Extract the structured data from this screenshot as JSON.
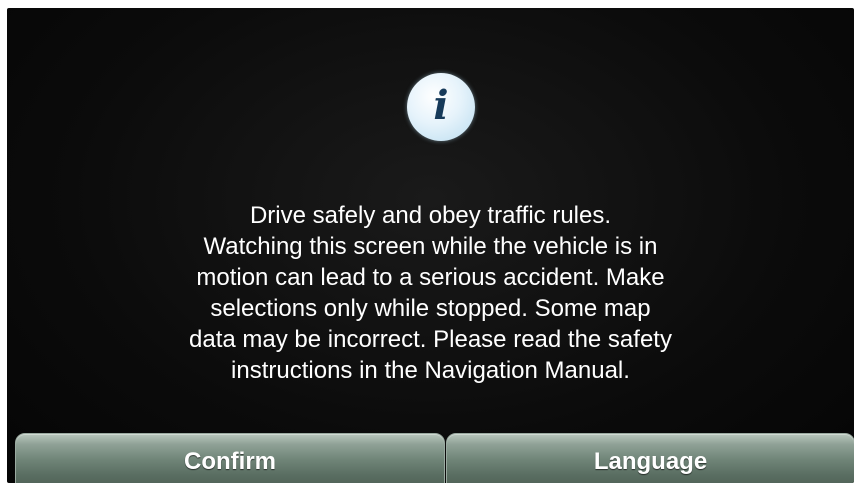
{
  "dialog": {
    "icon": "info-icon",
    "icon_glyph": "i",
    "message_lines": [
      "Drive safely and obey traffic rules.",
      "Watching this screen while the vehicle is in",
      "motion can lead to a serious accident. Make",
      "selections only while stopped. Some map",
      "data may be incorrect. Please read the safety",
      "instructions in the Navigation Manual."
    ]
  },
  "buttons": {
    "confirm_label": "Confirm",
    "language_label": "Language"
  },
  "colors": {
    "background": "#0b0b0b",
    "text": "#ffffff",
    "button": "#6f8477",
    "icon_fill": "#e6f3fb",
    "icon_glyph": "#163a5a"
  }
}
